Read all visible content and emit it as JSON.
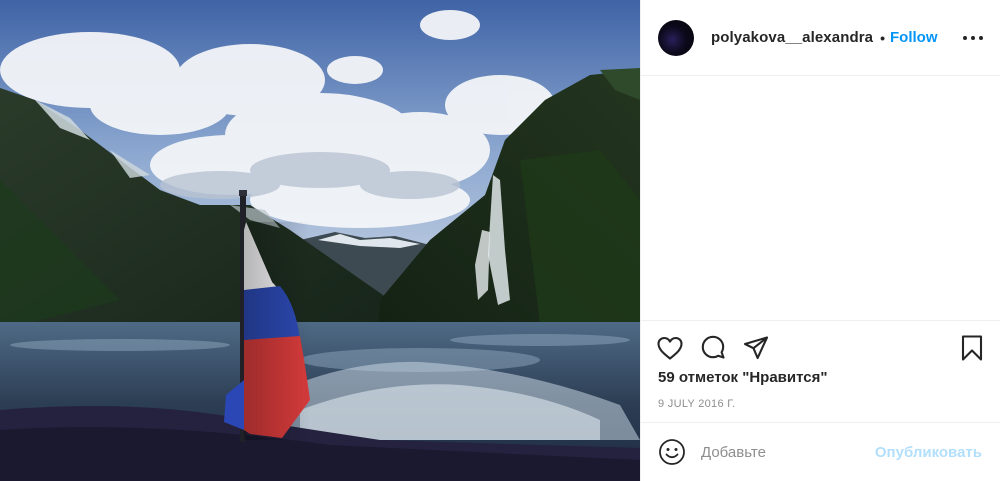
{
  "post": {
    "image_alt": "",
    "author": {
      "username": "polyakova__alexandra",
      "separator": "•",
      "follow_label": "Follow"
    },
    "more_icon": "more-horizontal-icon",
    "actions": {
      "like_icon": "heart-icon",
      "comment_icon": "comment-icon",
      "share_icon": "send-icon",
      "save_icon": "bookmark-icon"
    },
    "likes_text": "59 отметок \"Нравится\"",
    "date_text": "9 JULY 2016 Г.",
    "comment": {
      "emoji_icon": "emoji-icon",
      "placeholder": "Добавьте",
      "value": "",
      "publish_label": "Опубликовать"
    }
  },
  "colors": {
    "link_blue": "#0095f6",
    "publish_disabled": "#b2dffc",
    "text": "#262626",
    "muted": "#8e8e8e",
    "divider": "#efefef"
  }
}
